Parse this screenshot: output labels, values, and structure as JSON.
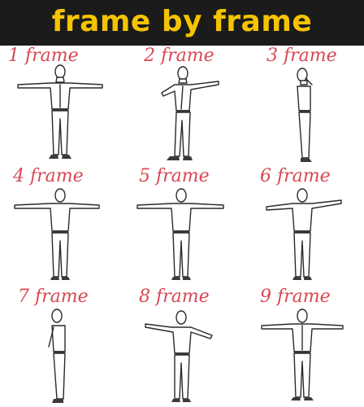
{
  "header": {
    "title": "frame by frame"
  },
  "frames": [
    {
      "label": "1 frame",
      "view": "front"
    },
    {
      "label": "2 frame",
      "view": "three-quarter"
    },
    {
      "label": "3 frame",
      "view": "side"
    },
    {
      "label": "4 frame",
      "view": "back"
    },
    {
      "label": "5 frame",
      "view": "back"
    },
    {
      "label": "6 frame",
      "view": "back-three-quarter"
    },
    {
      "label": "7 frame",
      "view": "side"
    },
    {
      "label": "8 frame",
      "view": "three-quarter"
    },
    {
      "label": "9 frame",
      "view": "front"
    }
  ],
  "colors": {
    "header_bg": "#1b1b1b",
    "title": "#f5c400",
    "label": "#d84852",
    "line": "#2a2a2a"
  }
}
